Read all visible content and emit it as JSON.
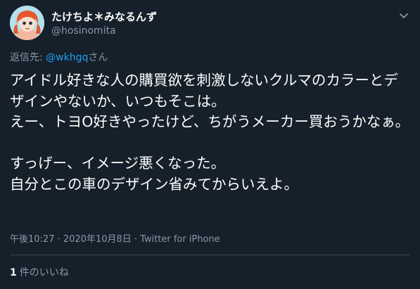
{
  "author": {
    "display_name": "たけちよ＊みなるんず",
    "handle": "@hosinomita",
    "avatar": "avatar-icon"
  },
  "reply": {
    "prefix": "返信先: ",
    "mention": "@wkhgq",
    "suffix": "さん"
  },
  "tweet": {
    "text": "アイドル好きな人の購買欲を刺激しないクルマのカラーとデザインやないか、いつもそこは。\nえー、トヨO好きやったけど、ちがうメーカー買おうかなぁ。\n\nすっげー、イメージ悪くなった。\n自分とこの車のデザイン省みてからいえよ。"
  },
  "meta": {
    "timestamp": "午後10:27 · 2020年10月8日 · Twitter for iPhone"
  },
  "likes": {
    "count": "1",
    "label": "件のいいね"
  },
  "colors": {
    "background": "#15202b",
    "text": "#ffffff",
    "muted": "#8899a6",
    "link": "#1da1f2",
    "divider": "#38444d"
  },
  "icons": [
    "avatar-icon",
    "chevron-down-icon"
  ]
}
